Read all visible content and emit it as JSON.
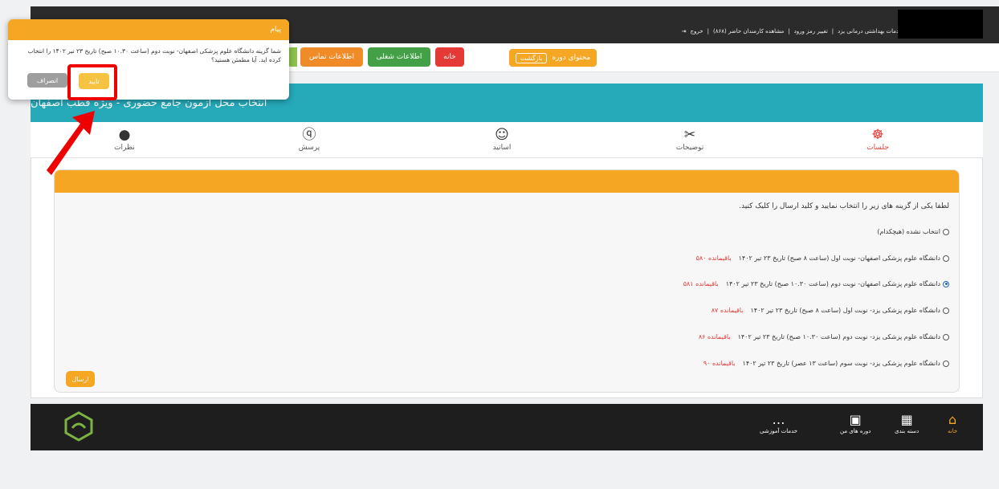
{
  "topbar": {
    "links": [
      "خدمات بهداشتی درمانی یزد",
      "|",
      "تغییر رمز ورود",
      "|",
      "مشاهده کارمندان حاضر (۸۶۸)",
      "|",
      "خروج"
    ]
  },
  "nav": {
    "home": "خانه",
    "job_info": "اطلاعات شغلی",
    "contact_info": "اطلاعات تماس",
    "course_content": "محتوای دوره",
    "back": "بازگشت"
  },
  "page_title": "انتخاب محل آزمون جامع حضوری - ویژه قطب اصفهان",
  "tabs": [
    {
      "label": "جلسات",
      "icon": "sessions-icon"
    },
    {
      "label": "توضیحات",
      "icon": "description-icon"
    },
    {
      "label": "اساتید",
      "icon": "teachers-icon"
    },
    {
      "label": "پرسش",
      "icon": "question-icon"
    },
    {
      "label": "نظرات",
      "icon": "comments-icon"
    }
  ],
  "form": {
    "instruction": "لطفا یکی از گزینه های زیر را انتخاب نمایید و کلید ارسال را کلیک کنید.",
    "options": [
      {
        "label": "انتخاب نشده (هیچکدام)",
        "remaining": "",
        "checked": false
      },
      {
        "label": "دانشگاه علوم پزشکی اصفهان- نوبت اول (ساعت ۸ صبح) تاریخ ۲۳ تیر ۱۴۰۲",
        "remaining": "باقیمانده ۵۸۰",
        "checked": false
      },
      {
        "label": "دانشگاه علوم پزشکی اصفهان- نوبت دوم (ساعت ۱۰.۳۰ صبح) تاریخ ۲۳ تیر ۱۴۰۲",
        "remaining": "باقیمانده ۵۸۱",
        "checked": true
      },
      {
        "label": "دانشگاه علوم پزشکی یزد- نوبت اول (ساعت ۸ صبح) تاریخ ۲۳ تیر ۱۴۰۲",
        "remaining": "باقیمانده ۸۷",
        "checked": false
      },
      {
        "label": "دانشگاه علوم پزشکی یزد- نوبت دوم (ساعت ۱۰.۳۰ صبح) تاریخ ۲۳ تیر ۱۴۰۲",
        "remaining": "باقیمانده ۸۶",
        "checked": false
      },
      {
        "label": "دانشگاه علوم پزشکی یزد- نوبت سوم (ساعت ۱۳ عصر) تاریخ ۲۳ تیر ۱۴۰۲",
        "remaining": "باقیمانده ۹۰",
        "checked": false
      }
    ],
    "send": "ارسال"
  },
  "footer": {
    "home": "خانه",
    "categories": "دسته بندی",
    "my_courses": "دوره های من",
    "edu_services": "خدمات آموزشی"
  },
  "modal": {
    "title": "پیام",
    "message": "شما گزینه دانشگاه علوم پزشکی اصفهان- نوبت دوم (ساعت ۱۰.۳۰ صبح) تاریخ ۲۳ تیر ۱۴۰۲ را انتخاب کرده اید. آیا مطمئن هستید؟",
    "confirm": "تایید",
    "cancel": "انصراف"
  },
  "colors": {
    "accent": "#f5a623",
    "teal": "#26a9b9",
    "danger": "#e53935",
    "success": "#43a047"
  }
}
